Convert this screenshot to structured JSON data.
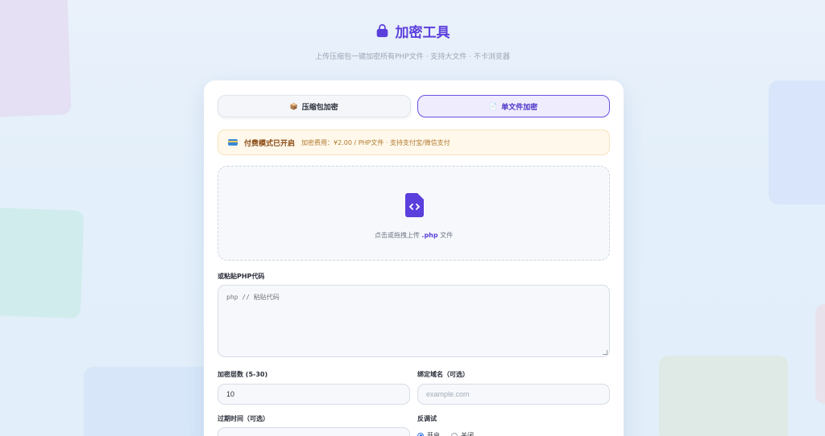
{
  "header": {
    "title": "加密工具",
    "subtitle": "上传压缩包一键加密所有PHP文件 · 支持大文件 · 不卡浏览器"
  },
  "tabs": [
    {
      "label": "压缩包加密",
      "icon": "package-icon",
      "selected": false
    },
    {
      "label": "单文件加密",
      "icon": "file-icon",
      "selected": true
    }
  ],
  "notice": {
    "icon": "credit-card-icon",
    "title": "付费模式已开启",
    "text": "加密费用：¥2.00 / PHP文件 · 支持支付宝/微信支付"
  },
  "upload": {
    "icon": "php-file-icon",
    "prefix": "点击或拖拽上传",
    "ext": ".php",
    "suffix": "文件"
  },
  "code": {
    "label": "或粘贴PHP代码",
    "placeholder": "php // 粘贴代码"
  },
  "layers": {
    "label": "加密层数 (5-30)",
    "value": "10"
  },
  "domain": {
    "label": "绑定域名（可选）",
    "placeholder": "example.com"
  },
  "expire": {
    "label": "过期时间（可选）",
    "value": ""
  },
  "debug": {
    "label": "反调试",
    "options": [
      {
        "label": "开启",
        "checked": true
      },
      {
        "label": "关闭",
        "checked": false
      }
    ]
  },
  "colors": {
    "accent": "#5b3fdc",
    "notice_bg": "#fff8eb"
  }
}
